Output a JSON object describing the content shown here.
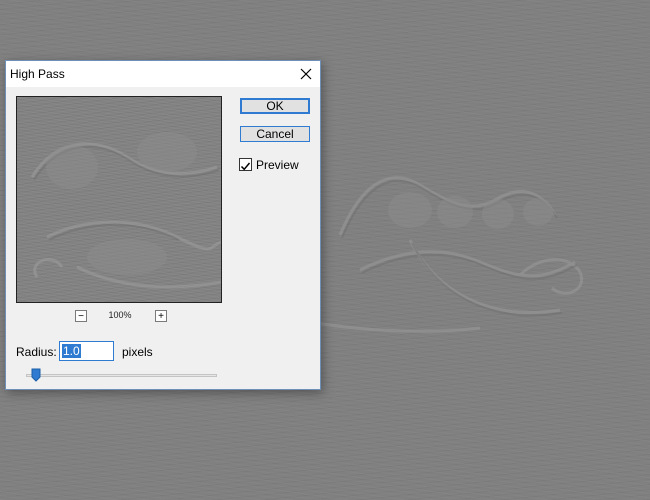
{
  "dialog": {
    "title": "High Pass",
    "close_label": "×"
  },
  "buttons": {
    "ok_label": "OK",
    "cancel_label": "Cancel"
  },
  "preview": {
    "checkbox_label": "Preview",
    "checked": true,
    "zoom_out_label": "−",
    "zoom_in_label": "+",
    "zoom_level": "100%"
  },
  "radius": {
    "label": "Radius:",
    "value": "1.0",
    "units": "pixels",
    "slider_fraction": 0.03
  },
  "colors": {
    "accent": "#2f7bd1",
    "dialog_bg": "#f0f0f0",
    "canvas_gray": "#808080"
  }
}
